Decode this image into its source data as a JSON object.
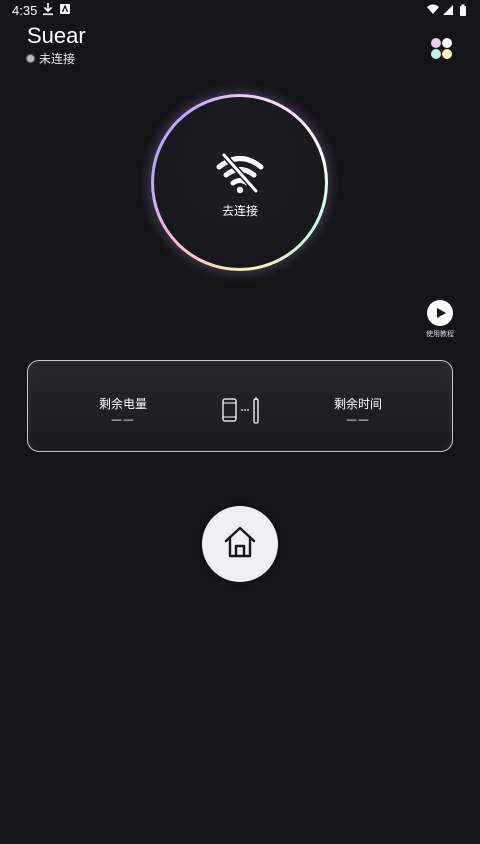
{
  "status_bar": {
    "time": "4:35",
    "icons": [
      "download-icon",
      "a-badge-icon",
      "wifi-signal-icon",
      "cellular-signal-icon",
      "battery-icon"
    ]
  },
  "header": {
    "app_name": "Suear",
    "connection_status": "未连接",
    "menu_icon": "four-dots-menu-icon",
    "menu_dot_colors": [
      "#f2c9ee",
      "#ffffff",
      "#b9f4e6",
      "#fbf7b9"
    ]
  },
  "connect": {
    "label": "去连接",
    "icon": "wifi-off-icon"
  },
  "tutorial": {
    "label": "使用教程",
    "icon": "play-icon"
  },
  "battery_card": {
    "remaining_battery_label": "剩余电量",
    "remaining_battery_value": "——",
    "remaining_time_label": "剩余时间",
    "remaining_time_value": "——",
    "icon": "phone-to-device-icon"
  },
  "bottom": {
    "home_icon": "home-icon"
  }
}
